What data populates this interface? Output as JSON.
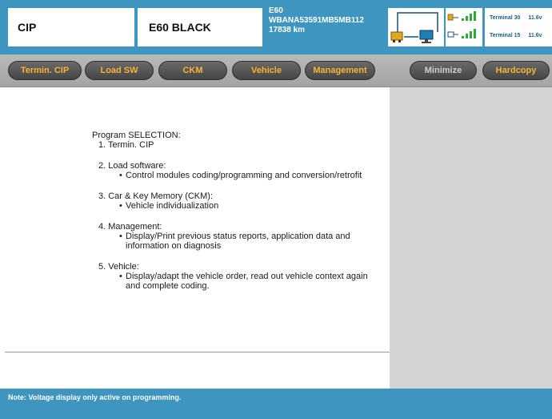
{
  "header": {
    "app_name": "CIP",
    "model": "E60 BLACK",
    "vehicle": {
      "series": "E60",
      "vin": "WBANA53591MB5MB112",
      "mileage": "17838 km"
    },
    "terminal_30": {
      "label": "Terminal 30",
      "value": "11.6v"
    },
    "terminal_15": {
      "label": "Terminal 15",
      "value": "11.6v"
    }
  },
  "toolbar": {
    "buttons": [
      "Termin. CIP",
      "Load SW",
      "CKM",
      "Vehicle",
      "Management",
      "Minimize",
      "Hardcopy"
    ]
  },
  "content": {
    "title": "Program SELECTION:",
    "items": [
      {
        "label": "1.  Termin. CIP",
        "bullets": []
      },
      {
        "label": "2.  Load software:",
        "bullets": [
          "Control modules coding/programming and conversion/retrofit"
        ]
      },
      {
        "label": "3.  Car & Key Memory (CKM):",
        "bullets": [
          "Vehicle individualization"
        ]
      },
      {
        "label": "4.  Management:",
        "bullets": [
          "Display/Print previous status reports, application data and information on diagnosis"
        ]
      },
      {
        "label": "5.  Vehicle:",
        "bullets": [
          "Display/adapt the vehicle order, read out vehicle context again and complete coding."
        ]
      }
    ]
  },
  "footer": {
    "note": "Note: Voltage display only active on programming."
  },
  "colors": {
    "header_blue": "#3e95c0",
    "button_text_orange": "#f0b64b",
    "button_dark": "#505050",
    "right_panel_grey": "#d4d4d4"
  }
}
